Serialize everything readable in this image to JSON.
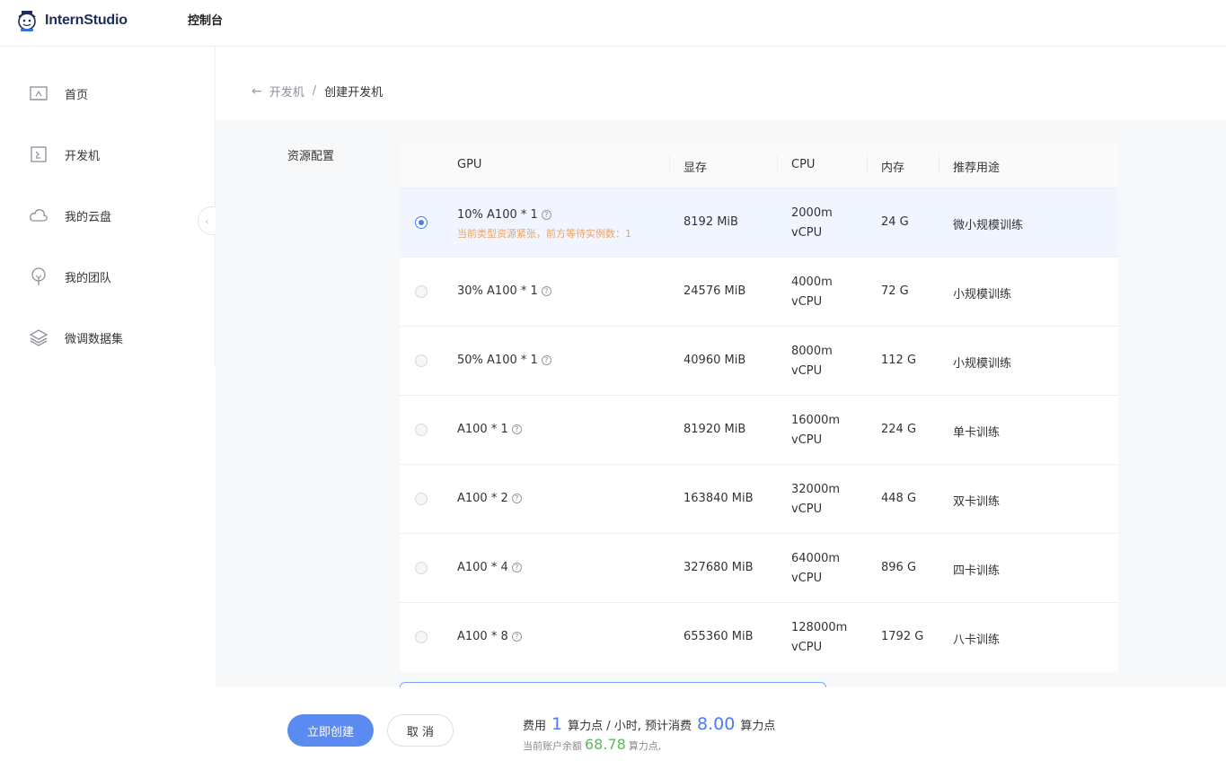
{
  "header": {
    "logo_text": "InternStudio",
    "nav_title": "控制台"
  },
  "sidebar": {
    "items": [
      {
        "label": "首页",
        "icon": "home-icon"
      },
      {
        "label": "开发机",
        "icon": "terminal-icon"
      },
      {
        "label": "我的云盘",
        "icon": "cloud-icon"
      },
      {
        "label": "我的团队",
        "icon": "tree-icon"
      },
      {
        "label": "微调数据集",
        "icon": "layers-icon"
      }
    ],
    "collapse_icon": "chevron-left-icon"
  },
  "breadcrumb": {
    "back_icon": "arrow-left-icon",
    "parent": "开发机",
    "separator": "/",
    "current": "创建开发机"
  },
  "resource": {
    "section_label": "资源配置",
    "columns": [
      "GPU",
      "显存",
      "CPU",
      "内存",
      "推荐用途"
    ],
    "rows": [
      {
        "gpu": "10% A100 * 1",
        "warning": "当前类型资源紧张，前方等待实例数：1",
        "mem": "8192 MiB",
        "cpu1": "2000m",
        "cpu2": "vCPU",
        "ram": "24 G",
        "use": "微小规模训练",
        "selected": true
      },
      {
        "gpu": "30% A100 * 1",
        "mem": "24576 MiB",
        "cpu1": "4000m",
        "cpu2": "vCPU",
        "ram": "72 G",
        "use": "小规模训练",
        "selected": false
      },
      {
        "gpu": "50% A100 * 1",
        "mem": "40960 MiB",
        "cpu1": "8000m",
        "cpu2": "vCPU",
        "ram": "112 G",
        "use": "小规模训练",
        "selected": false
      },
      {
        "gpu": "A100 * 1",
        "mem": "81920 MiB",
        "cpu1": "16000m",
        "cpu2": "vCPU",
        "ram": "224 G",
        "use": "单卡训练",
        "selected": false
      },
      {
        "gpu": "A100 * 2",
        "mem": "163840 MiB",
        "cpu1": "32000m",
        "cpu2": "vCPU",
        "ram": "448 G",
        "use": "双卡训练",
        "selected": false
      },
      {
        "gpu": "A100 * 4",
        "mem": "327680 MiB",
        "cpu1": "64000m",
        "cpu2": "vCPU",
        "ram": "896 G",
        "use": "四卡训练",
        "selected": false
      },
      {
        "gpu": "A100 * 8",
        "mem": "655360 MiB",
        "cpu1": "128000m",
        "cpu2": "vCPU",
        "ram": "1792 G",
        "use": "八卡训练",
        "selected": false
      }
    ],
    "help_glyph": "?"
  },
  "footer": {
    "create_label": "立即创建",
    "cancel_label": "取 消",
    "fee_prefix": "费用",
    "fee_rate": "1",
    "fee_mid": "算力点 / 小时, 预计消费",
    "fee_total": "8.00",
    "fee_suffix": "算力点",
    "balance_prefix": "当前账户余额",
    "balance_value": "68.78",
    "balance_suffix": "算力点,"
  },
  "colors": {
    "accent": "#4a7df2",
    "button": "#5b8af0",
    "warning": "#f0a35c",
    "balance": "#5cb85c"
  }
}
